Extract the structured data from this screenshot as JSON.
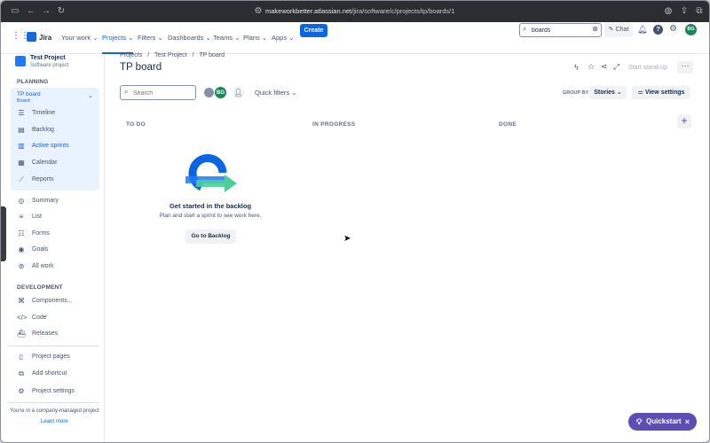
{
  "browser": {
    "url_domain": "makeworkbetter.atlassian.net",
    "url_path": "/jira/software/c/projects/tp/boards/1"
  },
  "nav": {
    "product": "Jira",
    "items": [
      "Your work",
      "Projects",
      "Filters",
      "Dashboards",
      "Teams",
      "Plans",
      "Apps"
    ],
    "create_label": "Create",
    "search_value": "boards",
    "chat_label": "Chat",
    "avatar_initials": "BG"
  },
  "sidebar": {
    "project_name": "Test Project",
    "project_type": "Software project",
    "planning_heading": "PLANNING",
    "board_name": "TP board",
    "board_sub": "Board",
    "planning_items": [
      "Timeline",
      "Backlog",
      "Active sprints",
      "Calendar",
      "Reports"
    ],
    "other_items": [
      "Summary",
      "List",
      "Forms",
      "Goals",
      "All work"
    ],
    "development_heading": "DEVELOPMENT",
    "development_items": [
      "Components...",
      "Code",
      "Releases"
    ],
    "footer_items": [
      "Project pages",
      "Add shortcut",
      "Project settings"
    ],
    "footer_note": "You're in a company-managed project",
    "learn_more": "Learn more"
  },
  "main": {
    "breadcrumb": [
      "Projects",
      "Test Project",
      "TP board"
    ],
    "title": "TP board",
    "start_standup": "Start stand-up",
    "search_placeholder": "Search",
    "avatar_initials": "BG",
    "quick_filters": "Quick filters",
    "group_by_label": "GROUP BY",
    "group_by_value": "Stories",
    "view_settings": "View settings",
    "columns": [
      "TO DO",
      "IN PROGRESS",
      "DONE"
    ],
    "empty_title": "Get started in the backlog",
    "empty_text": "Plan and start a sprint to see work here.",
    "go_backlog": "Go to Backlog"
  },
  "quickstart": "Quickstart",
  "colors": {
    "accent": "#0c66e4",
    "quickstart": "#5e4db2",
    "avatar": "#1f845a"
  }
}
